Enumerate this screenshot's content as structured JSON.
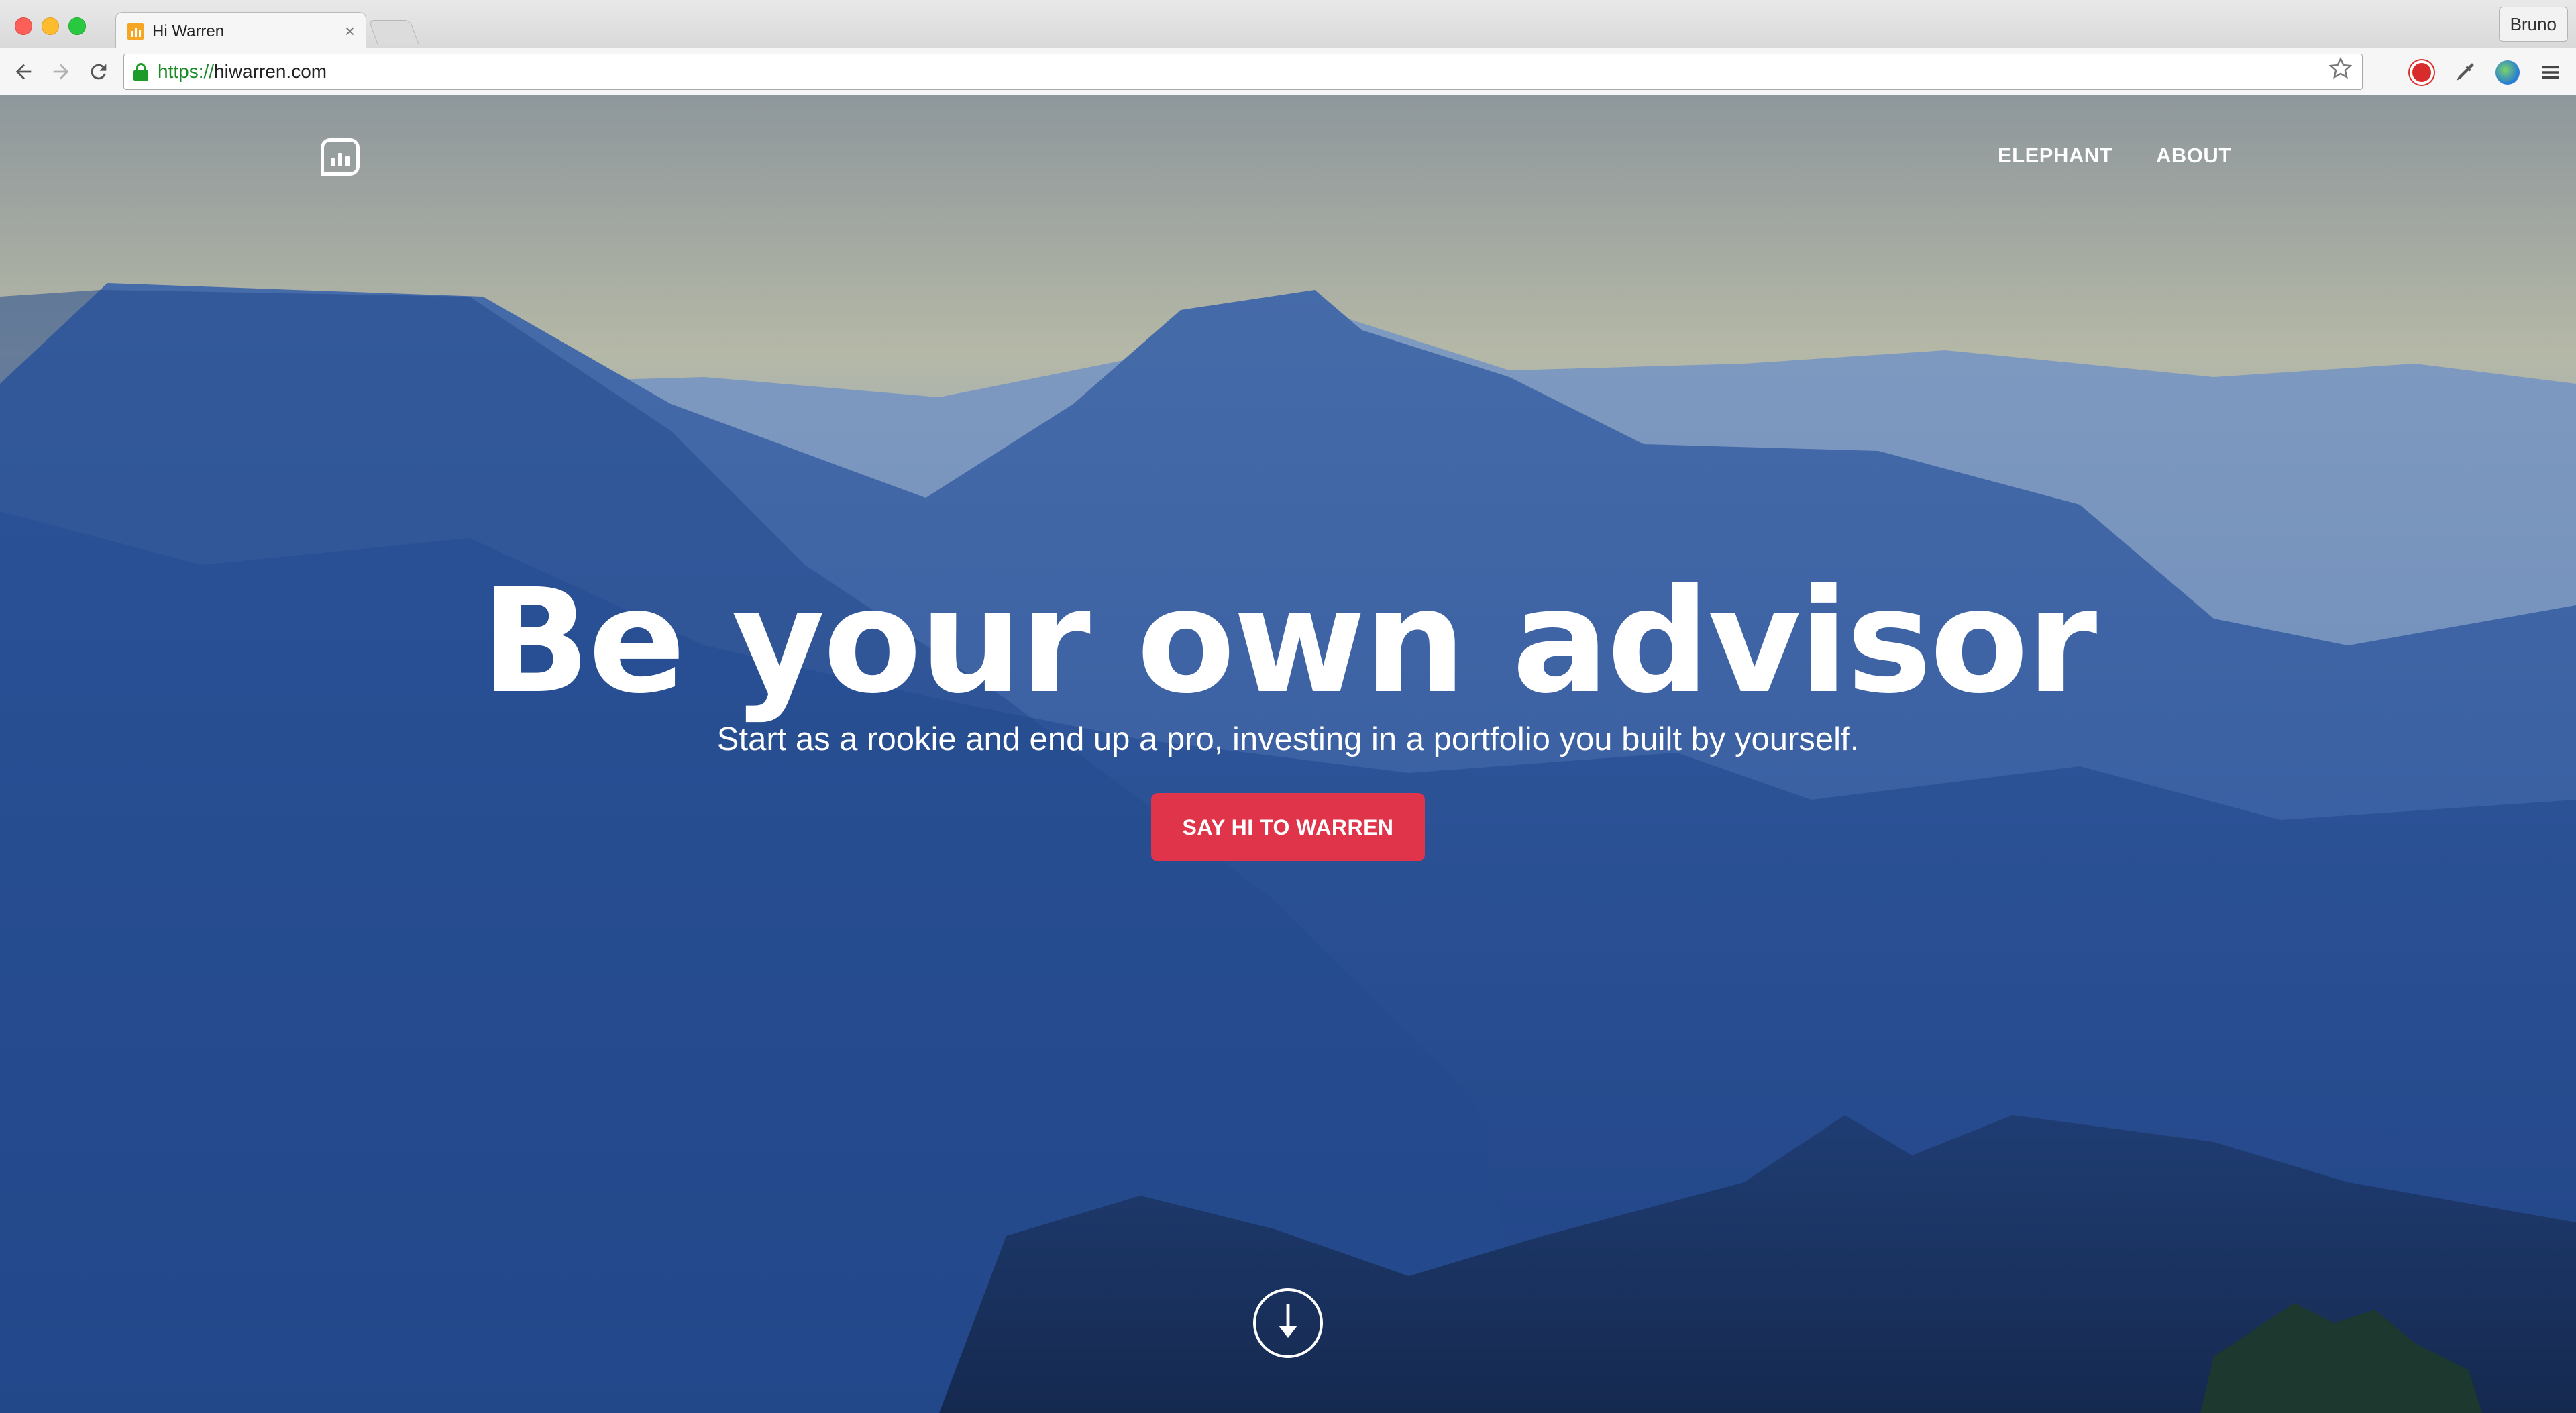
{
  "browser": {
    "tab": {
      "title": "Hi Warren",
      "close_glyph": "×"
    },
    "profile_name": "Bruno",
    "url": {
      "scheme": "https://",
      "host": "hiwarren.com"
    },
    "icons": [
      "back-icon",
      "forward-icon",
      "reload-icon",
      "lock-icon",
      "star-icon",
      "adblock-extension-icon",
      "eyedropper-extension-icon",
      "globe-extension-icon",
      "menu-icon"
    ]
  },
  "site": {
    "nav": {
      "elephant": "ELEPHANT",
      "about": "ABOUT"
    },
    "hero": {
      "title": "Be your own advisor",
      "subtitle": "Start as a rookie and end up a pro, investing in a portfolio you built by yourself.",
      "cta": "SAY HI TO WARREN"
    },
    "colors": {
      "cta": "#e0344a",
      "hero_blue": "#2f5aa3"
    }
  }
}
